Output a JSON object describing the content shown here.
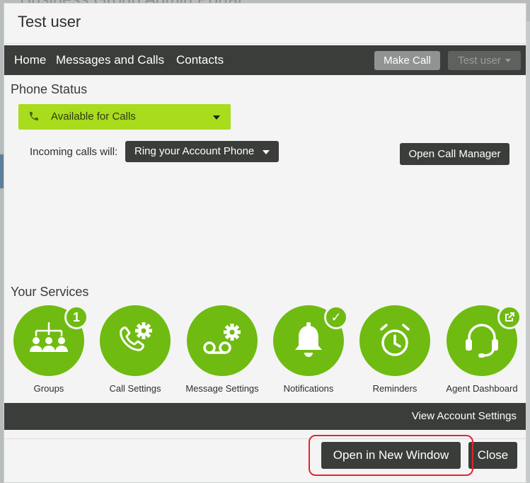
{
  "backdrop": {
    "title": "Business Group Admin Portal"
  },
  "dialog": {
    "title": "Test user"
  },
  "nav": {
    "items": [
      {
        "label": "Home"
      },
      {
        "label": "Messages and Calls"
      },
      {
        "label": "Contacts"
      }
    ],
    "make_call_label": "Make Call",
    "user_menu_label": "Test user"
  },
  "phone_status": {
    "heading": "Phone Status",
    "status_value": "Available for Calls",
    "incoming_label": "Incoming calls will:",
    "incoming_value": "Ring your Account Phone",
    "call_manager_label": "Open Call Manager"
  },
  "services": {
    "heading": "Your Services",
    "items": [
      {
        "label": "Groups",
        "icon": "groups-icon",
        "badge": "1"
      },
      {
        "label": "Call Settings",
        "icon": "call-settings-icon",
        "badge": ""
      },
      {
        "label": "Message Settings",
        "icon": "voicemail-settings-icon",
        "badge": ""
      },
      {
        "label": "Notifications",
        "icon": "bell-icon",
        "badge": "✓"
      },
      {
        "label": "Reminders",
        "icon": "alarm-clock-icon",
        "badge": ""
      },
      {
        "label": "Agent Dashboard",
        "icon": "headset-icon",
        "badge": "external-link-icon"
      }
    ]
  },
  "footer": {
    "view_settings_label": "View Account Settings",
    "open_new_window_label": "Open in New Window",
    "close_label": "Close"
  },
  "colors": {
    "accent_green": "#6fbb11",
    "status_green": "#a8dc1c",
    "dark_bar": "#3a3d39",
    "highlight_red": "#e02630"
  }
}
